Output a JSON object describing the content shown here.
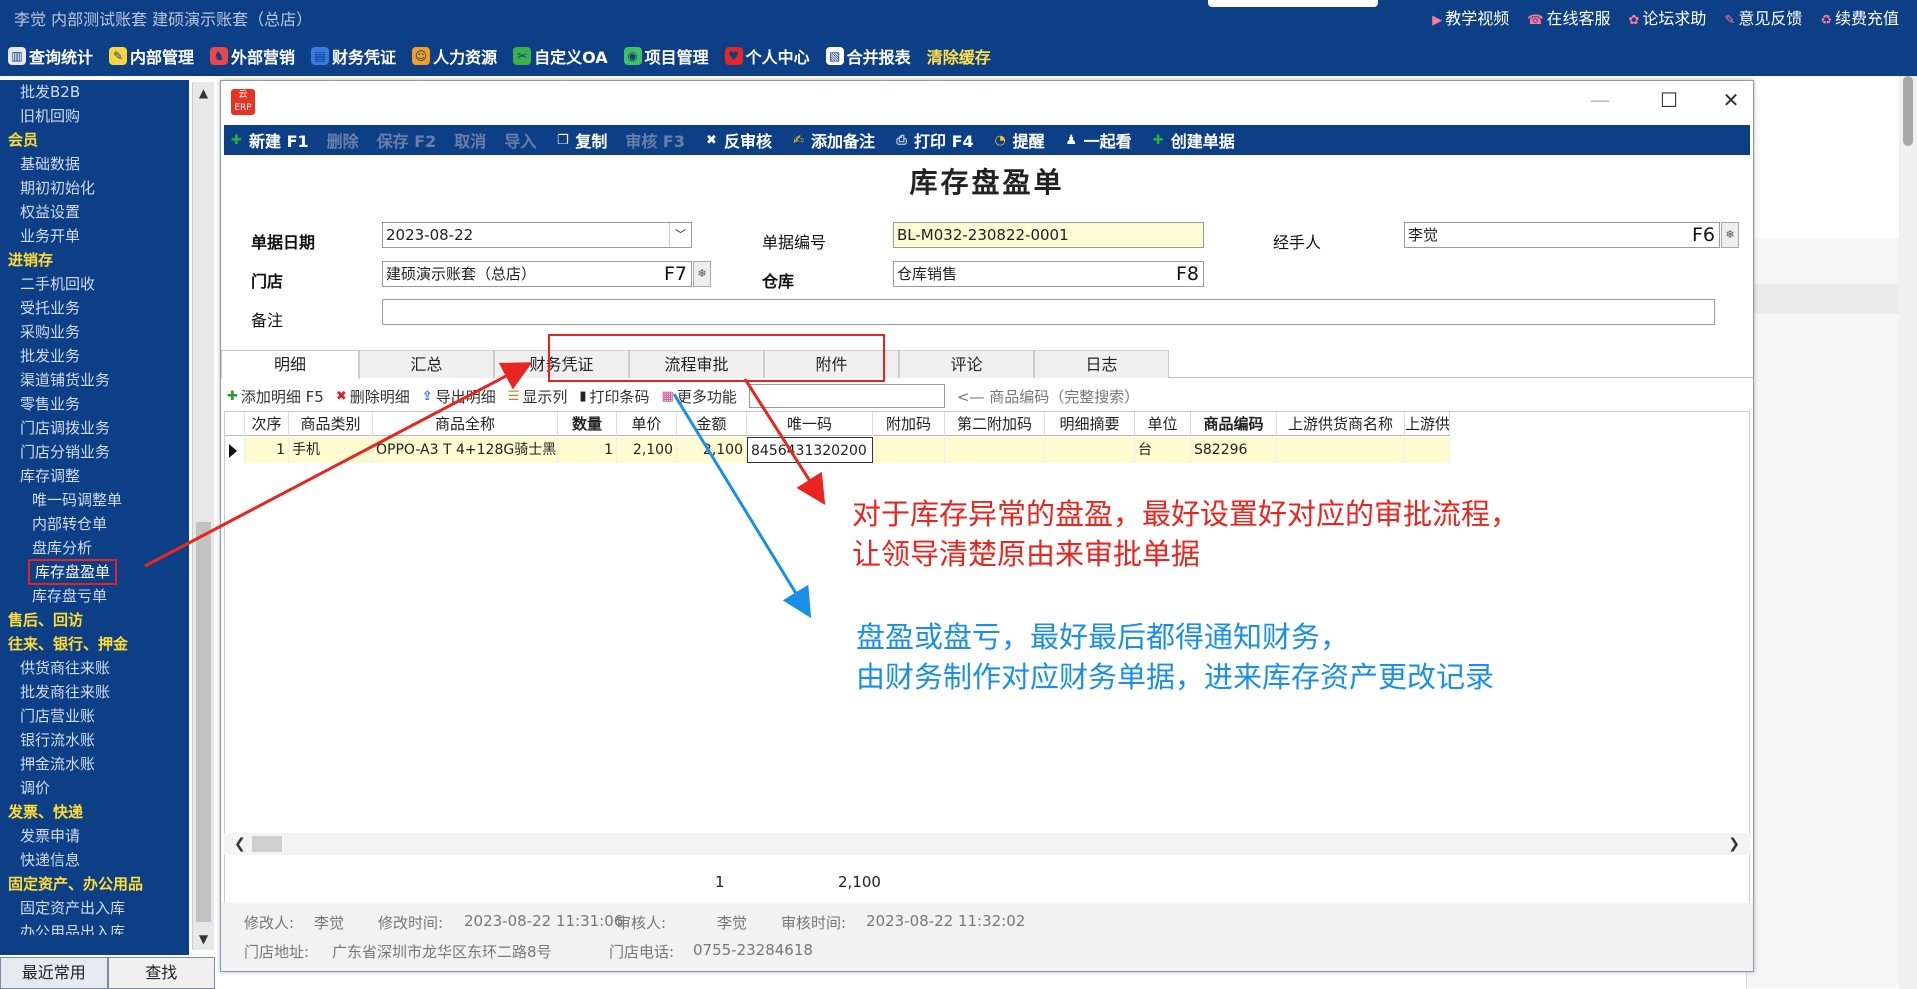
{
  "header": {
    "title": "李觉   内部测试账套    建硕演示账套（总店）",
    "links": [
      {
        "label": "教学视频",
        "icon": "video-icon"
      },
      {
        "label": "在线客服",
        "icon": "service-icon"
      },
      {
        "label": "论坛求助",
        "icon": "forum-icon"
      },
      {
        "label": "意见反馈",
        "icon": "feedback-icon"
      },
      {
        "label": "续费充值",
        "icon": "recharge-icon"
      }
    ]
  },
  "menu": [
    {
      "label": "查询统计",
      "icon": "chart-icon",
      "color": "#ffffff"
    },
    {
      "label": "内部管理",
      "icon": "pencil-icon",
      "color": "#ffffff"
    },
    {
      "label": "外部营销",
      "icon": "marketing-icon",
      "color": "#ffffff"
    },
    {
      "label": "财务凭证",
      "icon": "voucher-icon",
      "color": "#ffffff"
    },
    {
      "label": "人力资源",
      "icon": "person-icon",
      "color": "#ffffff"
    },
    {
      "label": "自定义OA",
      "icon": "tools-icon",
      "color": "#ffffff"
    },
    {
      "label": "项目管理",
      "icon": "project-icon",
      "color": "#ffffff"
    },
    {
      "label": "个人中心",
      "icon": "heart-icon",
      "color": "#ffffff"
    },
    {
      "label": "合并报表",
      "icon": "report-icon",
      "color": "#ffffff"
    },
    {
      "label": "清除缓存",
      "icon": "",
      "color": "#ffe24a"
    }
  ],
  "sidebar": [
    {
      "label": "批发B2B",
      "type": "item"
    },
    {
      "label": "旧机回购",
      "type": "item"
    },
    {
      "label": "会员",
      "type": "cat"
    },
    {
      "label": "基础数据",
      "type": "item"
    },
    {
      "label": "期初初始化",
      "type": "item"
    },
    {
      "label": "权益设置",
      "type": "item"
    },
    {
      "label": "业务开单",
      "type": "item"
    },
    {
      "label": "进销存",
      "type": "cat"
    },
    {
      "label": "二手机回收",
      "type": "item"
    },
    {
      "label": "受托业务",
      "type": "item"
    },
    {
      "label": "采购业务",
      "type": "item"
    },
    {
      "label": "批发业务",
      "type": "item"
    },
    {
      "label": "渠道铺货业务",
      "type": "item"
    },
    {
      "label": "零售业务",
      "type": "item"
    },
    {
      "label": "门店调拨业务",
      "type": "item"
    },
    {
      "label": "门店分销业务",
      "type": "item"
    },
    {
      "label": "库存调整",
      "type": "item"
    },
    {
      "label": "唯一码调整单",
      "type": "sub"
    },
    {
      "label": "内部转仓单",
      "type": "sub"
    },
    {
      "label": "盘库分析",
      "type": "sub"
    },
    {
      "label": "库存盘盈单",
      "type": "sel"
    },
    {
      "label": "库存盘亏单",
      "type": "sub"
    },
    {
      "label": "售后、回访",
      "type": "cat"
    },
    {
      "label": "往来、银行、押金",
      "type": "cat"
    },
    {
      "label": "供货商往来账",
      "type": "item"
    },
    {
      "label": "批发商往来账",
      "type": "item"
    },
    {
      "label": "门店营业账",
      "type": "item"
    },
    {
      "label": "银行流水账",
      "type": "item"
    },
    {
      "label": "押金流水账",
      "type": "item"
    },
    {
      "label": "调价",
      "type": "item"
    },
    {
      "label": "发票、快递",
      "type": "cat"
    },
    {
      "label": "发票申请",
      "type": "item"
    },
    {
      "label": "快递信息",
      "type": "item"
    },
    {
      "label": "固定资产、办公用品",
      "type": "cat"
    },
    {
      "label": "固定资产出入库",
      "type": "item"
    },
    {
      "label": "办公用品出入库",
      "type": "item"
    }
  ],
  "bottom_tabs": {
    "recent": "最近常用",
    "search": "查找"
  },
  "window": {
    "logo_text": "云ERP",
    "min": "—",
    "max": "☐",
    "close": "✕",
    "toolbar": [
      {
        "label": "新建 F1",
        "icon": "plus-icon",
        "enabled": true
      },
      {
        "label": "删除",
        "icon": "",
        "enabled": false
      },
      {
        "label": "保存 F2",
        "icon": "",
        "enabled": false
      },
      {
        "label": "取消",
        "icon": "",
        "enabled": false
      },
      {
        "label": "导入",
        "icon": "",
        "enabled": false
      },
      {
        "label": "复制",
        "icon": "copy-icon",
        "enabled": true
      },
      {
        "label": "审核 F3",
        "icon": "",
        "enabled": false
      },
      {
        "label": "反审核",
        "icon": "cancel-circle-icon",
        "enabled": true
      },
      {
        "label": "添加备注",
        "icon": "note-icon",
        "enabled": true
      },
      {
        "label": "打印 F4",
        "icon": "printer-icon",
        "enabled": true
      },
      {
        "label": "提醒",
        "icon": "clock-icon",
        "enabled": true
      },
      {
        "label": "一起看",
        "icon": "people-icon",
        "enabled": true
      },
      {
        "label": "创建单据",
        "icon": "plus-icon",
        "enabled": true
      }
    ],
    "form_title": "库存盘盈单",
    "form": {
      "date_label": "单据日期",
      "date_value": "2023-08-22",
      "docno_label": "单据编号",
      "docno_value": "BL-M032-230822-0001",
      "handler_label": "经手人",
      "handler_value": "李觉",
      "handler_key": "F6",
      "store_label": "门店",
      "store_value": "建硕演示账套（总店）",
      "store_key": "F7",
      "warehouse_label": "仓库",
      "warehouse_value": "仓库销售",
      "warehouse_key": "F8",
      "remark_label": "备注",
      "remark_value": ""
    },
    "tabs": [
      "明细",
      "汇总",
      "财务凭证",
      "流程审批",
      "附件",
      "评论",
      "日志"
    ],
    "active_tab": "明细",
    "detail_toolbar": [
      {
        "label": "添加明细 F5",
        "icon": "plus-icon",
        "color": "#2a9a2a"
      },
      {
        "label": "删除明细",
        "icon": "delete-icon",
        "color": "#e02020"
      },
      {
        "label": "导出明细",
        "icon": "export-icon",
        "color": "#2a6ad0"
      },
      {
        "label": "显示列",
        "icon": "columns-icon",
        "color": "#d08020"
      },
      {
        "label": "打印条码",
        "icon": "barcode-icon",
        "color": "#222222"
      },
      {
        "label": "更多功能",
        "icon": "more-icon",
        "color": "#d04080"
      }
    ],
    "search_hint": "<— 商品编码（完整搜索）",
    "grid": {
      "columns": [
        "次序",
        "商品类别",
        "商品全称",
        "数量",
        "单价",
        "金额",
        "唯一码",
        "附加码",
        "第二附加码",
        "明细摘要",
        "单位",
        "商品编码",
        "上游供货商名称",
        "上游供"
      ],
      "rows": [
        [
          "1",
          "手机",
          "OPPO-A3 T 4+128G骑士黑",
          "1",
          "2,100",
          "2,100",
          "8456431320200",
          "",
          "",
          "",
          "台",
          "S82296",
          "",
          ""
        ]
      ]
    },
    "totals": {
      "qty": "1",
      "amount": "2,100"
    },
    "footer": {
      "modifier_label": "修改人:",
      "modifier": "李觉",
      "modtime_label": "修改时间:",
      "modtime": "2023-08-22 11:31:06",
      "auditor_label": "审核人:",
      "auditor": "李觉",
      "audittime_label": "审核时间:",
      "audittime": "2023-08-22 11:32:02",
      "address_label": "门店地址:",
      "address": "广东省深圳市龙华区东环二路8号",
      "phone_label": "门店电话:",
      "phone": "0755-23284618"
    }
  },
  "annotations": {
    "red_line1": "对于库存异常的盘盈，最好设置好对应的审批流程，",
    "red_line2": "让领导清楚原由来审批单据",
    "blue_line1": "盘盈或盘亏，最好最后都得通知财务，",
    "blue_line2": "由财务制作对应财务单据，进来库存资产更改记录",
    "red_color": "#e8251e",
    "blue_color": "#1a8fe8"
  }
}
